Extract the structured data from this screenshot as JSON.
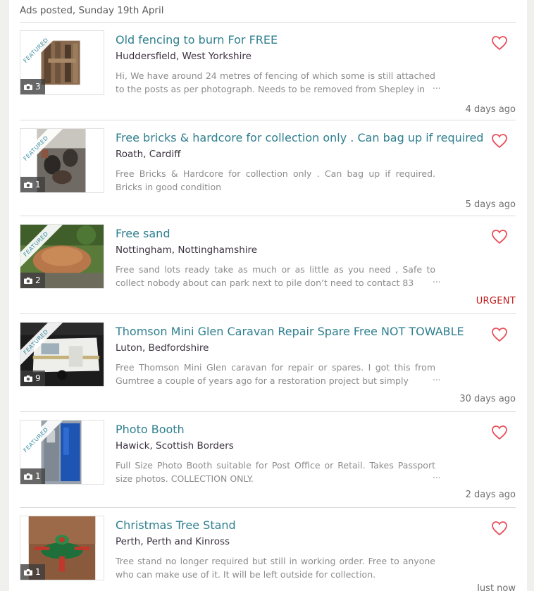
{
  "header": {
    "date_label": "Ads posted, Sunday 19th April"
  },
  "featured_label": "FEATURED",
  "colors": {
    "title": "#2e7f8f",
    "heart": "#e8505b",
    "urgent": "#c21d1d"
  },
  "listings": [
    {
      "title": "Old fencing to burn For FREE",
      "location": "Huddersfield, West Yorkshire",
      "description": "Hi, We have around 24 metres of fencing of which some is still attached to the posts as per photograph. Needs to be removed from Shepley in",
      "ellipsis": "...",
      "photo_count": "3",
      "featured": true,
      "meta": "4 days ago",
      "urgent": false
    },
    {
      "title": "Free bricks & hardcore for collection only . Can bag up if required",
      "location": "Roath, Cardiff",
      "description": "Free Bricks & Hardcore for collection only . Can bag up if required. Bricks in good condition",
      "ellipsis": "",
      "photo_count": "1",
      "featured": true,
      "meta": "5 days ago",
      "urgent": false
    },
    {
      "title": "Free sand",
      "location": "Nottingham, Nottinghamshire",
      "description": "Free sand lots ready take as much or as little as you need , Safe to collect nobody about can park next to pile don’t need to contact 83",
      "ellipsis": "...",
      "photo_count": "2",
      "featured": true,
      "meta": "URGENT",
      "urgent": true
    },
    {
      "title": "Thomson Mini Glen Caravan Repair Spare Free NOT TOWABLE",
      "location": "Luton, Bedfordshire",
      "description": "Free Thomson Mini Glen caravan for repair or spares. I got this from Gumtree a couple of years ago for a restoration project but simply",
      "ellipsis": "...",
      "photo_count": "9",
      "featured": true,
      "meta": "30 days ago",
      "urgent": false
    },
    {
      "title": "Photo Booth",
      "location": "Hawick, Scottish Borders",
      "description": "Full Size Photo Booth suitable for Post Office or Retail. Takes Passport size photos. COLLECTION ONLY.",
      "ellipsis": "...",
      "photo_count": "1",
      "featured": true,
      "meta": "2 days ago",
      "urgent": false
    },
    {
      "title": "Christmas Tree Stand",
      "location": "Perth, Perth and Kinross",
      "description": "Tree stand no longer required but still in working order. Free to anyone who can make use of it. It will be left outside for collection.",
      "ellipsis": "...",
      "photo_count": "1",
      "featured": false,
      "meta": "",
      "urgent": false
    }
  ],
  "bottom_meta": "Just now"
}
